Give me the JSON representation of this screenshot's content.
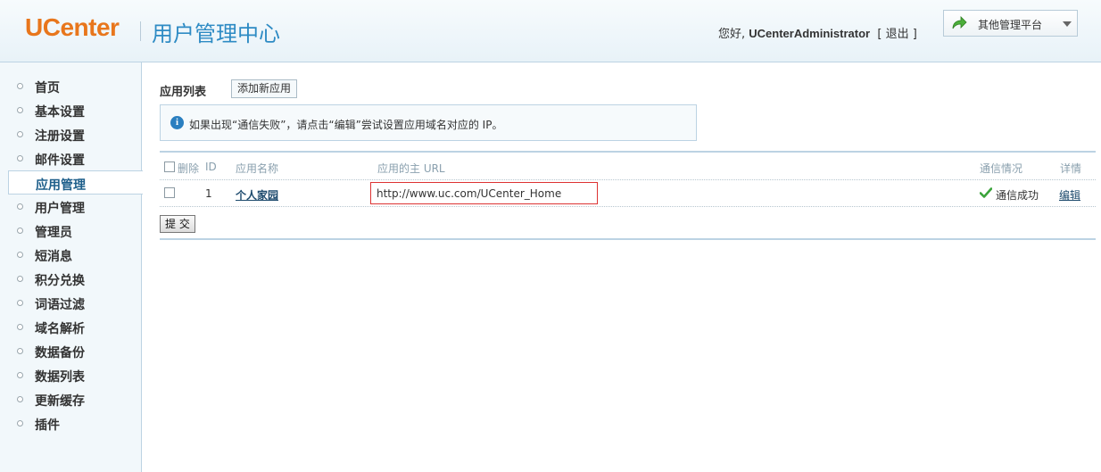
{
  "header": {
    "logo": "UCenter",
    "title": "用户管理中心",
    "greeting": "您好,",
    "username": "UCenterAdministrator",
    "logout_open": "[",
    "logout": "退出",
    "logout_close": "]",
    "platform_menu": "其他管理平台"
  },
  "sidebar": {
    "items": [
      {
        "label": "首页"
      },
      {
        "label": "基本设置"
      },
      {
        "label": "注册设置"
      },
      {
        "label": "邮件设置"
      },
      {
        "label": "应用管理",
        "active": true
      },
      {
        "label": "用户管理"
      },
      {
        "label": "管理员"
      },
      {
        "label": "短消息"
      },
      {
        "label": "积分兑换"
      },
      {
        "label": "词语过滤"
      },
      {
        "label": "域名解析"
      },
      {
        "label": "数据备份"
      },
      {
        "label": "数据列表"
      },
      {
        "label": "更新缓存"
      },
      {
        "label": "插件"
      }
    ]
  },
  "main": {
    "section_title": "应用列表",
    "add_button": "添加新应用",
    "notice": "如果出现“通信失败”，请点击“编辑”尝试设置应用域名对应的 IP。",
    "table": {
      "headers": {
        "delete": "删除",
        "id": "ID",
        "name": "应用名称",
        "url": "应用的主 URL",
        "status": "通信情况",
        "detail": "详情"
      },
      "rows": [
        {
          "id": "1",
          "name": "个人家园",
          "url": "http://www.uc.com/UCenter_Home",
          "status": "通信成功",
          "detail": "编辑"
        }
      ]
    },
    "submit_button": "提 交"
  },
  "colors": {
    "logo": "#e8761c",
    "title": "#2e8bc4",
    "highlight_border": "#dd3333",
    "success": "#3aa33a"
  }
}
